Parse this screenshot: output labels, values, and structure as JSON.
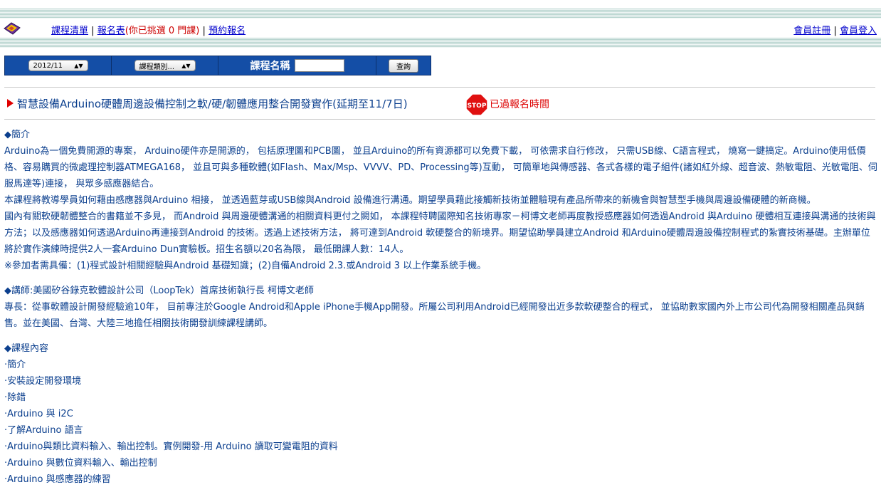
{
  "nav": {
    "course_list": "課程清單",
    "sep1": "|",
    "signup_form": "報名表",
    "selected_text": "(你已挑選 0 門課)",
    "sep2": "|",
    "reserve": "預約報名",
    "member_register": "會員註冊",
    "sep3": "|",
    "member_login": "會員登入"
  },
  "search": {
    "month_value": "2012/11",
    "category_value": "課程類別...",
    "name_label": "課程名稱",
    "name_value": "",
    "button_label": "查詢"
  },
  "course": {
    "title": "智慧設備Arduino硬體周邊設備控制之軟/硬/韌體應用整合開發實作(延期至11/7日)",
    "stop_icon_text": "STOP",
    "status": "已過報名時間"
  },
  "intro": {
    "heading": "◆簡介",
    "p1": "Arduino為一個免費開源的專案， Arduino硬件亦是開源的， 包括原理圖和PCB圖， 並且Arduino的所有資源都可以免費下載， 可依需求自行修改， 只需USB線、C語言程式， 燒寫一鍵搞定。Arduino使用低價格、容易購買的微處理控制器ATMEGA168， 並且可與多種軟體(如Flash、Max/Msp、VVVV、PD、Processing等)互動， 可簡單地與傳感器、各式各樣的電子組件(諸如紅外線、超音波、熱敏電阻、光敏電阻、伺服馬達等)連接， 與眾多感應器結合。",
    "p2": "本課程將教導學員如何藉由感應器與Arduino 相接， 並透過藍芽或USB線與Android 設備進行溝通。期望學員藉此接觸新技術並體驗現有產品所帶來的新機會與智慧型手機與周邊設備硬體的新商機。",
    "p3": "國內有關軟硬韌體整合的書籍並不多見， 而Android 與周邊硬體溝通的相關資料更付之闕如， 本課程特聘國際知名技術專家－柯博文老師再度教授感應器如何透過Android 與Arduino 硬體相互連接與溝通的技術與方法；以及感應器如何透過Arduino再連接到Android 的技術。透過上述技術方法， 將可達到Android 軟硬整合的新境界。期望協助學員建立Android 和Arduino硬體周邊設備控制程式的紮實技術基礎。主辦單位將於實作演練時提供2人一套Arduino Dun實驗板。招生名額以20名為限， 最低開課人數：14人。",
    "p4": "※參加者需具備：(1)程式設計相關經驗與Android 基礎知識；(2)自備Android 2.3.或Android 3 以上作業系統手機。"
  },
  "lecturer": {
    "heading": "◆講師:美國矽谷錄克軟體設計公司（LoopTek）首席技術執行長 柯博文老師",
    "bio": "專長：從事軟體設計開發經驗逾10年， 目前專注於Google Android和Apple iPhone手機App開發。所屬公司利用Android已經開發出近多款軟硬整合的程式， 並協助數家國內外上市公司代為開發相關產品與銷售。並在美國、台灣、大陸三地擔任相關技術開發訓練課程講師。"
  },
  "syllabus": {
    "heading": "◆課程內容",
    "items": [
      "·簡介",
      "·安裝設定開發環境",
      "·除錯",
      "·Arduino 與 i2C",
      "·了解Arduino 語言",
      "·Arduino與類比資料輸入、輸出控制。實例開發-用 Arduino 讀取可變電阻的資料",
      "·Arduino 與數位資料輸入、輸出控制",
      "·Arduino 與感應器的練習"
    ]
  },
  "colors": {
    "accent_blue": "#144ea6",
    "text_blue": "#0b3f8e",
    "link_blue": "#0000cc",
    "alert_red": "#dd0000"
  }
}
